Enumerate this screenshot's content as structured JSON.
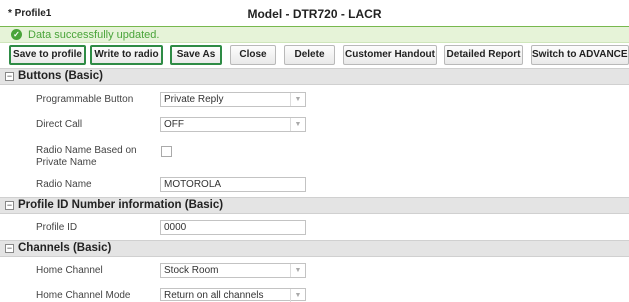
{
  "header": {
    "profile_name": "* Profile1",
    "model_title": "Model - DTR720 - LACR"
  },
  "status": {
    "message": "Data successfully updated."
  },
  "toolbar": {
    "save_to_profile": "Save to profile",
    "write_to_radio": "Write to radio",
    "save_as": "Save As",
    "close": "Close",
    "delete": "Delete",
    "customer_handout": "Customer Handout",
    "detailed_report": "Detailed Report",
    "switch_advanced": "Switch to ADVANCED"
  },
  "sections": {
    "buttons": {
      "title": "Buttons (Basic)",
      "programmable_button_label": "Programmable Button",
      "programmable_button_value": "Private Reply",
      "direct_call_label": "Direct Call",
      "direct_call_value": "OFF",
      "radio_name_private_label": "Radio Name Based on Private Name",
      "radio_name_private_checked": false,
      "radio_name_label": "Radio Name",
      "radio_name_value": "MOTOROLA"
    },
    "profile_id": {
      "title": "Profile ID Number information (Basic)",
      "profile_id_label": "Profile ID",
      "profile_id_value": "0000"
    },
    "channels": {
      "title": "Channels (Basic)",
      "home_channel_label": "Home Channel",
      "home_channel_value": "Stock Room",
      "home_channel_mode_label": "Home Channel Mode",
      "home_channel_mode_value": "Return on all channels"
    }
  },
  "colors": {
    "success_green": "#4aa43a",
    "highlight_border": "#2e8b45",
    "section_bg": "#e4e4e4"
  }
}
